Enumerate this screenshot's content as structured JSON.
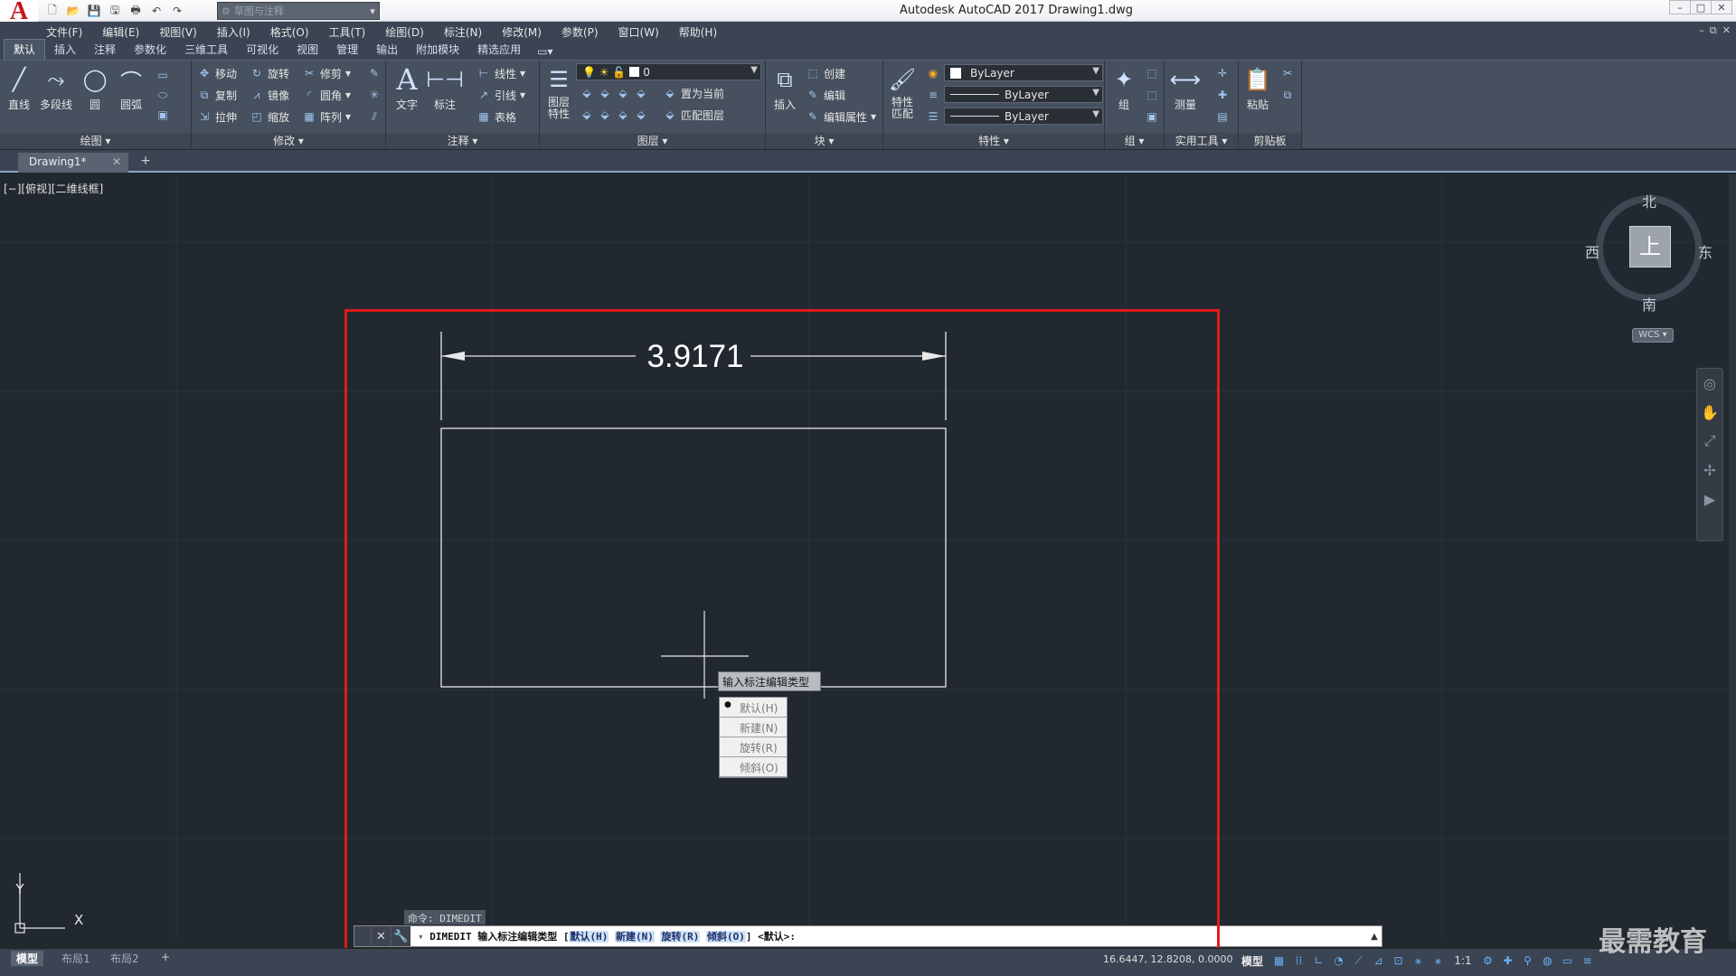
{
  "app": {
    "logo": "A",
    "window_title": "Autodesk AutoCAD 2017    Drawing1.dwg",
    "workspace": "草图与注释",
    "window_controls": [
      "–",
      "□",
      "✕"
    ],
    "mdi_controls": [
      "–",
      "⧉",
      "✕"
    ]
  },
  "qat": [
    "new-icon",
    "open-icon",
    "save-icon",
    "saveas-icon",
    "print-icon",
    "undo-icon",
    "redo-icon"
  ],
  "menus": [
    "文件(F)",
    "编辑(E)",
    "视图(V)",
    "插入(I)",
    "格式(O)",
    "工具(T)",
    "绘图(D)",
    "标注(N)",
    "修改(M)",
    "参数(P)",
    "窗口(W)",
    "帮助(H)"
  ],
  "ribbon_tabs": [
    "默认",
    "插入",
    "注释",
    "参数化",
    "三维工具",
    "可视化",
    "视图",
    "管理",
    "输出",
    "附加模块",
    "精选应用"
  ],
  "ribbon": {
    "draw": {
      "title": "绘图",
      "line": "直线",
      "polyline": "多段线",
      "circle": "圆",
      "arc": "圆弧"
    },
    "modify": {
      "title": "修改",
      "move": "移动",
      "rotate": "旋转",
      "trim": "修剪",
      "copy": "复制",
      "mirror": "镜像",
      "fillet": "圆角",
      "stretch": "拉伸",
      "scale": "缩放",
      "array": "阵列"
    },
    "annotation": {
      "title": "注释",
      "text": "文字",
      "dimension": "标注",
      "linear": "线性",
      "leader": "引线",
      "table": "表格"
    },
    "layers": {
      "title": "图层",
      "layer_props": "图层\n特性",
      "layer_value": "0",
      "set_current": "置为当前",
      "match_layer": "匹配图层"
    },
    "block": {
      "title": "块",
      "insert": "插入",
      "create": "创建",
      "edit": "编辑",
      "edit_attr": "编辑属性"
    },
    "properties": {
      "title": "特性",
      "match": "特性\n匹配",
      "color": "ByLayer",
      "linetype": "ByLayer",
      "lineweight": "ByLayer"
    },
    "groups": {
      "title": "组",
      "group": "组"
    },
    "utilities": {
      "title": "实用工具",
      "measure": "测量"
    },
    "clipboard": {
      "title": "剪贴板",
      "paste": "粘贴"
    }
  },
  "document_tab": {
    "name": "Drawing1*",
    "close": "✕",
    "plus": "+"
  },
  "viewport_label": "[−][俯视][二维线框]",
  "drawing": {
    "dimension_value": "3.9171"
  },
  "viewcube": {
    "north": "北",
    "south": "南",
    "east": "东",
    "west": "西",
    "face": "上",
    "wcs": "WCS"
  },
  "ucs": {
    "x": "X",
    "y": "Y"
  },
  "dimedit_prompt": {
    "tooltip": "输入标注编辑类型",
    "options": [
      "默认(H)",
      "新建(N)",
      "旋转(R)",
      "倾斜(O)"
    ],
    "selected": "默认(H)"
  },
  "command": {
    "history": "命令: DIMEDIT",
    "prefix": "DIMEDIT 输入标注编辑类型 [",
    "options": [
      "默认(H)",
      "新建(N)",
      "旋转(R)",
      "倾斜(O)"
    ],
    "suffix": "] <默认>:"
  },
  "layout_tabs": [
    "模型",
    "布局1",
    "布局2"
  ],
  "status": {
    "coords": "16.6447, 12.8208, 0.0000",
    "model": "模型",
    "scale": "1:1"
  },
  "watermark": "最需教育",
  "colors": {
    "canvas": "#212830",
    "accent": "#e21a1a",
    "ribbon": "#46505e"
  }
}
